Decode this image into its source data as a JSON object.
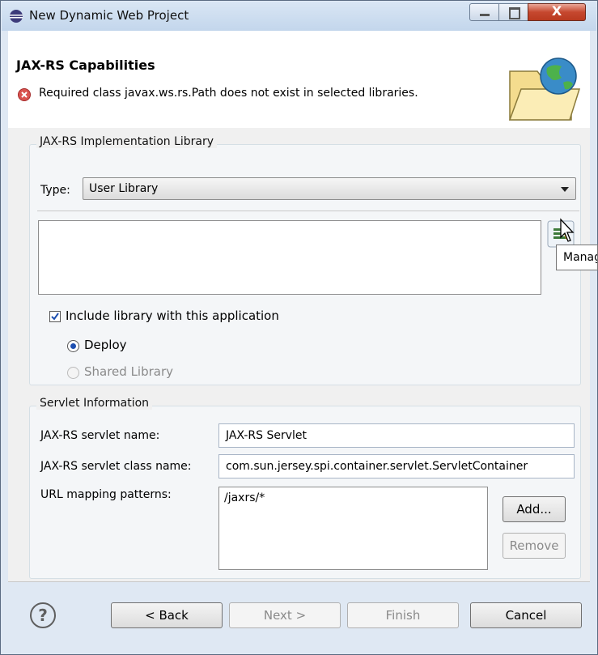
{
  "window": {
    "title": "New Dynamic Web Project",
    "close_glyph": "X"
  },
  "header": {
    "title": "JAX-RS Capabilities",
    "message": "Required class javax.ws.rs.Path does not exist in selected libraries."
  },
  "impl_group": {
    "title": "JAX-RS Implementation Library",
    "type_label": "Type:",
    "type_value": "User Library",
    "tooltip": "Manage libraries",
    "include_label": "Include library with this application",
    "include_checked": true,
    "deploy_label": "Deploy",
    "shared_label": "Shared Library"
  },
  "servlet_group": {
    "title": "Servlet Information",
    "name_label": "JAX-RS servlet name:",
    "name_value": "JAX-RS Servlet",
    "class_label": "JAX-RS servlet class name:",
    "class_value": "com.sun.jersey.spi.container.servlet.ServletContainer",
    "url_label": "URL mapping patterns:",
    "url_patterns": [
      "/jaxrs/*"
    ],
    "add_label": "Add...",
    "remove_label": "Remove"
  },
  "footer": {
    "help_glyph": "?",
    "back_label": "< Back",
    "next_label": "Next >",
    "finish_label": "Finish",
    "cancel_label": "Cancel"
  },
  "icons": [
    "eclipse-icon",
    "error-icon",
    "wizard-folder-globe-icon",
    "manage-libraries-icon",
    "mouse-cursor-icon",
    "help-icon"
  ]
}
